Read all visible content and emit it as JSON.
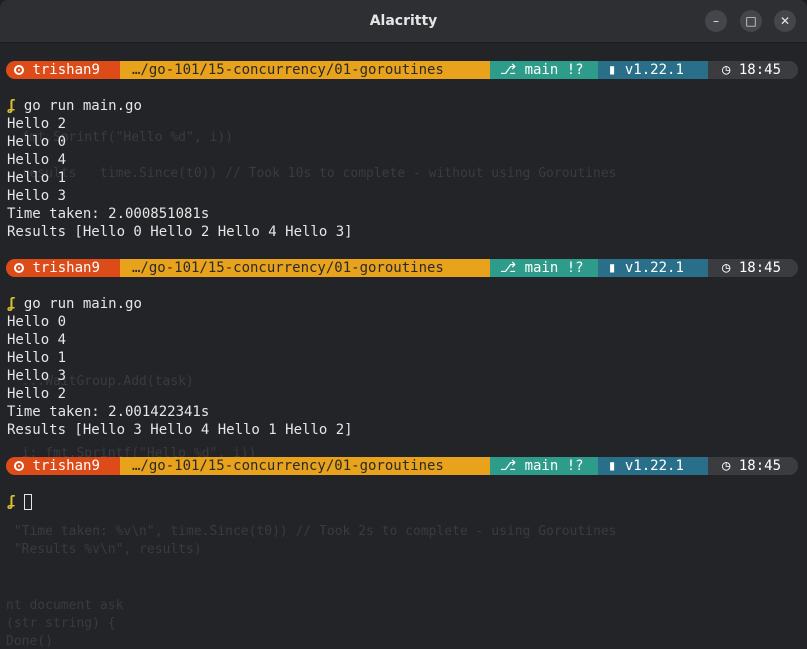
{
  "window": {
    "title": "Alacritty",
    "controls": {
      "minimize": "–",
      "maximize": "□",
      "close": "✕"
    }
  },
  "prompt": {
    "user": "trishan9",
    "path": "…/go-101/15-concurrency/01-goroutines",
    "git_branch": "main !?",
    "go_version": "v1.22.1",
    "time": "18:45",
    "symbol": "ʆ"
  },
  "runs": [
    {
      "command": "go run main.go",
      "output": [
        "Hello 2",
        "Hello 0",
        "Hello 4",
        "Hello 1",
        "Hello 3",
        "Time taken: 2.000851081s",
        "Results [Hello 0 Hello 2 Hello 4 Hello 3]"
      ]
    },
    {
      "command": "go run main.go",
      "output": [
        "Hello 0",
        "Hello 4",
        "Hello 1",
        "Hello 3",
        "Hello 2",
        "Time taken: 2.001422341s",
        "Results [Hello 3 Hello 4 Hello 1 Hello 2]"
      ]
    }
  ],
  "colors": {
    "user_segment": "#dd4b18",
    "path_segment": "#e8a21c",
    "git_segment": "#2e9c8a",
    "go_segment": "#2a6f89",
    "time_segment": "#3b3c40"
  }
}
